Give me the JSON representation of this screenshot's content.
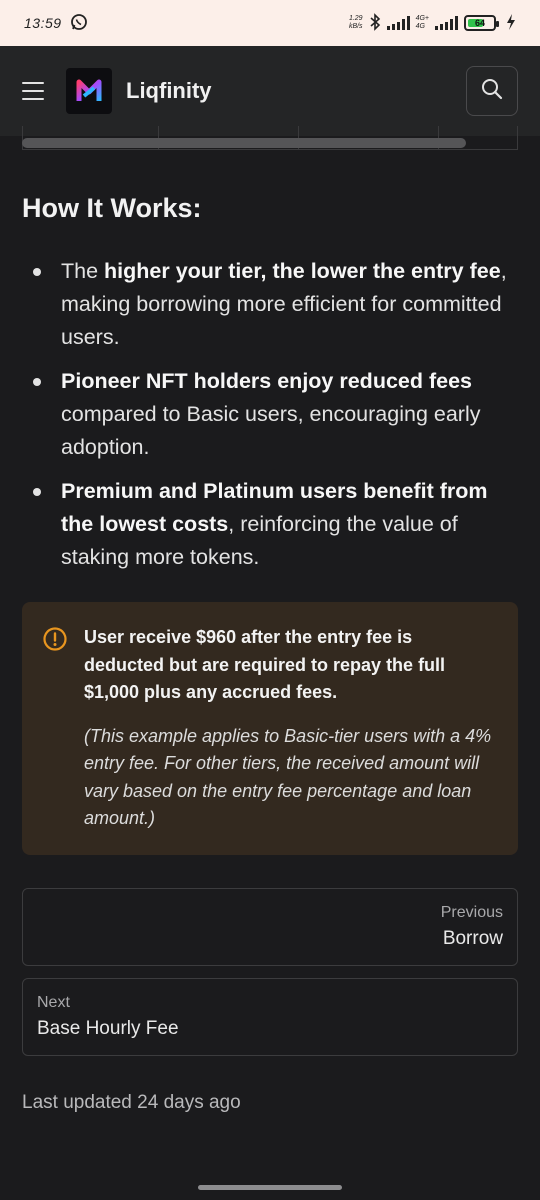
{
  "status_bar": {
    "time": "13:59",
    "net_speed_value": "1.29",
    "net_speed_unit": "kB/s",
    "net_type_top": "4G+",
    "net_type_bottom": "4G",
    "battery_percent": 64,
    "battery_label": "64",
    "icons": [
      "whatsapp-icon",
      "bluetooth-icon",
      "signal-icon",
      "battery-icon",
      "charging-icon"
    ]
  },
  "navbar": {
    "brand": "Liqfinity",
    "icons": [
      "menu-icon",
      "logo",
      "search-icon"
    ]
  },
  "content": {
    "heading": "How It Works:",
    "bullets": [
      {
        "pre": "The ",
        "bold": "higher your tier, the lower the entry fee",
        "post": ", making borrowing more efficient for committed users."
      },
      {
        "pre": "",
        "bold": "Pioneer NFT holders enjoy reduced fees",
        "post": " compared to Basic users, encouraging early adoption."
      },
      {
        "pre": "",
        "bold": "Premium and Platinum users benefit from the lowest costs",
        "post": ", reinforcing the value of staking more tokens."
      }
    ],
    "callout": {
      "main": "User receive $960 after the entry fee is deducted but are required to repay the full $1,000 plus any accrued fees.",
      "note": "(This example applies to Basic-tier users with a 4% entry fee. For other tiers, the received amount will vary based on the entry fee percentage and loan amount.)",
      "accent_color": "#e8951f"
    }
  },
  "pagination": {
    "previous": {
      "sub": "Previous",
      "label": "Borrow"
    },
    "next": {
      "sub": "Next",
      "label": "Base Hourly Fee"
    }
  },
  "footer": {
    "last_updated": "Last updated 24 days ago"
  }
}
